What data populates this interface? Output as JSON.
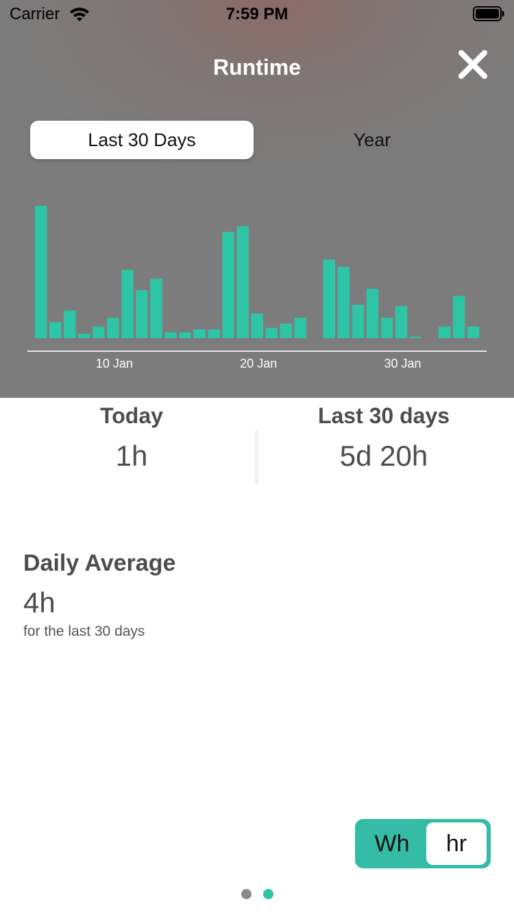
{
  "status_bar": {
    "carrier": "Carrier",
    "time": "7:59 PM"
  },
  "header": {
    "title": "Runtime",
    "close_icon": "close-icon"
  },
  "range_selector": {
    "options": [
      "Last 30 Days",
      "Year"
    ],
    "selected": "Last 30 Days"
  },
  "chart_data": {
    "type": "bar",
    "bar_color": "#2ec4a6",
    "values": [
      0.91,
      0.11,
      0.19,
      0.03,
      0.08,
      0.14,
      0.47,
      0.33,
      0.41,
      0.04,
      0.04,
      0.06,
      0.06,
      0.73,
      0.77,
      0.17,
      0.07,
      0.1,
      0.14,
      0,
      0.54,
      0.49,
      0.23,
      0.34,
      0.14,
      0.22,
      0.01,
      0,
      0.08,
      0.29,
      0.08
    ],
    "tick_labels": [
      "10 Jan",
      "20 Jan",
      "30 Jan"
    ],
    "tick_indices": [
      5,
      15,
      25
    ]
  },
  "stats": {
    "today": {
      "label": "Today",
      "value": "1h"
    },
    "last30": {
      "label": "Last 30 days",
      "value": "5d 20h"
    }
  },
  "daily_average": {
    "label": "Daily Average",
    "value": "4h",
    "caption": "for the last 30 days"
  },
  "unit_toggle": {
    "options": [
      "Wh",
      "hr"
    ],
    "selected": "hr",
    "accent": "#35bca5"
  },
  "pager": {
    "count": 2,
    "active": 2
  }
}
